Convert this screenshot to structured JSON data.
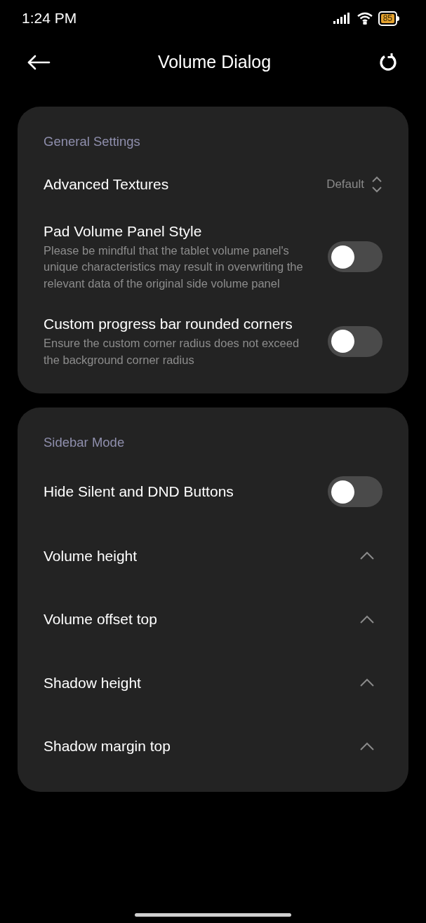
{
  "status_bar": {
    "time": "1:24 PM",
    "battery": "85"
  },
  "header": {
    "title": "Volume Dialog"
  },
  "sections": [
    {
      "title": "General Settings",
      "items": [
        {
          "kind": "dropdown",
          "label": "Advanced Textures",
          "value": "Default"
        },
        {
          "kind": "toggle",
          "label": "Pad Volume Panel Style",
          "description": "Please be mindful that the tablet volume panel's unique characteristics may result in overwriting the relevant data of the original side volume panel",
          "on": false
        },
        {
          "kind": "toggle",
          "label": "Custom progress bar rounded corners",
          "description": "Ensure the custom corner radius does not exceed the background corner radius",
          "on": false
        }
      ]
    },
    {
      "title": "Sidebar Mode",
      "items": [
        {
          "kind": "toggle",
          "label": "Hide Silent and DND Buttons",
          "on": false
        },
        {
          "kind": "expander",
          "label": "Volume height"
        },
        {
          "kind": "expander",
          "label": "Volume offset top"
        },
        {
          "kind": "expander",
          "label": "Shadow height"
        },
        {
          "kind": "expander",
          "label": "Shadow margin top"
        }
      ]
    }
  ]
}
